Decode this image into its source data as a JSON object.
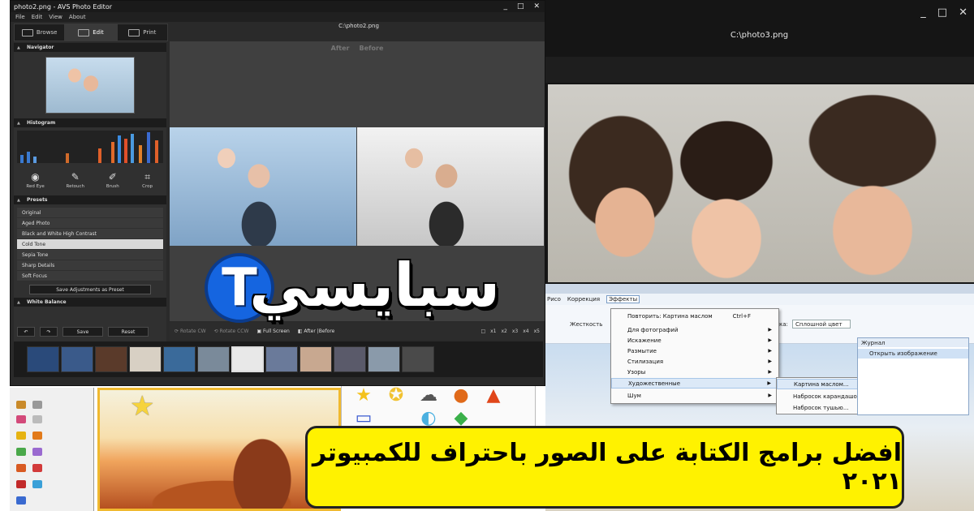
{
  "main_window": {
    "title": "photo2.png - AVS Photo Editor",
    "menu": [
      "File",
      "Edit",
      "View",
      "About"
    ],
    "window_controls": [
      "_",
      "□",
      "✕"
    ],
    "tabs": [
      {
        "label": "Browse",
        "active": false
      },
      {
        "label": "Edit",
        "active": true
      },
      {
        "label": "Print",
        "active": false
      }
    ],
    "path": "C:\\photo2.png",
    "sections": {
      "navigator": "Navigator",
      "histogram": "Histogram",
      "presets": "Presets",
      "white_balance": "White Balance"
    },
    "tools": [
      "Red Eye",
      "Retouch",
      "Brush",
      "Crop"
    ],
    "presets": [
      {
        "label": "Original",
        "selected": false
      },
      {
        "label": "Aged Photo",
        "selected": false
      },
      {
        "label": "Black and White High Contrast",
        "selected": false
      },
      {
        "label": "Cold Tone",
        "selected": true
      },
      {
        "label": "Sepia Tone",
        "selected": false
      },
      {
        "label": "Sharp Details",
        "selected": false
      },
      {
        "label": "Soft Focus",
        "selected": false
      }
    ],
    "save_preset_label": "Save Adjustments as Preset",
    "save_label": "Save",
    "reset_label": "Reset",
    "after_label": "After",
    "before_label": "Before",
    "bottombar": {
      "rotate_cw": "Rotate CW",
      "rotate_ccw": "Rotate CCW",
      "full_screen": "Full Screen",
      "after_before": "After |Before",
      "zoom": [
        "x1",
        "x2",
        "x3",
        "x4",
        "x5"
      ]
    },
    "filmstrip_count": 12,
    "filmstrip_selected": 6
  },
  "back_window": {
    "path": "C:\\photo3.png",
    "window_controls": [
      "_",
      "□",
      "✕"
    ]
  },
  "ru_window": {
    "menu": [
      "Рисо",
      "Коррекция",
      "Эффекты"
    ],
    "open_menu": "Эффекты",
    "toolbar": {
      "thickness_label": "Жесткость",
      "fill_label": "ка:",
      "fill_value": "Сплошной цвет"
    },
    "effects_menu": [
      {
        "label": "Повторить: Картина маслом",
        "shortcut": "Ctrl+F",
        "submenu": false
      },
      {
        "label": "Для фотографий",
        "submenu": true
      },
      {
        "label": "Искажение",
        "submenu": true
      },
      {
        "label": "Размытие",
        "submenu": true
      },
      {
        "label": "Стилизация",
        "submenu": true
      },
      {
        "label": "Узоры",
        "submenu": true
      },
      {
        "label": "Художественные",
        "submenu": true,
        "highlighted": true
      },
      {
        "label": "Шум",
        "submenu": true
      }
    ],
    "submenu": [
      {
        "label": "Картина маслом...",
        "highlighted": true
      },
      {
        "label": "Набросок карандашом..."
      },
      {
        "label": "Набросок тушью..."
      }
    ],
    "journal": {
      "title": "Журнал",
      "item": "Открыть изображение"
    }
  },
  "logo": {
    "badge_letter": "T",
    "text": "سبايسي"
  },
  "headline": "افضل برامج الكتابة على الصور باحتراف للكمبيوتر ٢٠٢١",
  "colors": {
    "headline_bg": "#fff200",
    "logo_blue": "#1565e0",
    "editor_dark": "#2a2a2a"
  }
}
